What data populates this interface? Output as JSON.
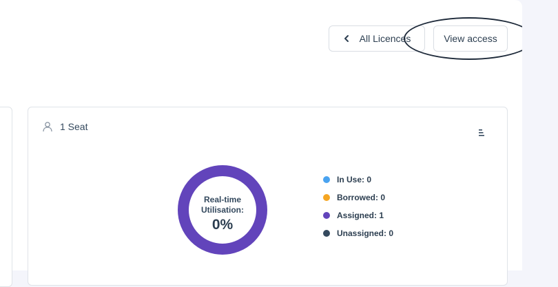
{
  "header": {
    "back_button_label": "All Licences",
    "view_access_label": "View access"
  },
  "card": {
    "seat_label": "1 Seat",
    "donut": {
      "label_line1": "Real-time",
      "label_line2": "Utilisation:",
      "value": "0%",
      "ring_color": "#6244bb"
    },
    "legend": [
      {
        "label": "In Use: 0",
        "color": "#4aa3f0"
      },
      {
        "label": "Borrowed: 0",
        "color": "#f5a623"
      },
      {
        "label": "Assigned: 1",
        "color": "#6244bb"
      },
      {
        "label": "Unassigned: 0",
        "color": "#34495e"
      }
    ]
  },
  "icons": {
    "back": "chevron-left-icon",
    "seat": "user-icon",
    "menu": "menu-icon"
  }
}
